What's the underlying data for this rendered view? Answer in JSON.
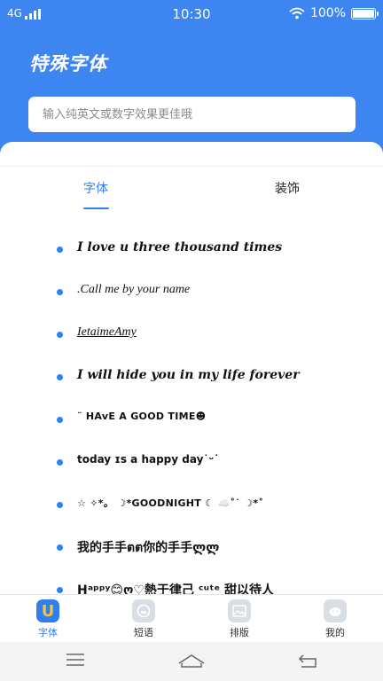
{
  "status_bar": {
    "network": "4G",
    "time": "10:30",
    "battery": "100%"
  },
  "app_title": "特殊字体",
  "search": {
    "placeholder": "输入纯英文或数字效果更佳哦",
    "value": ""
  },
  "tabs": [
    {
      "label": "字体",
      "active": true
    },
    {
      "label": "装饰",
      "active": false
    }
  ],
  "font_samples": [
    {
      "text": "I love u three thousand times"
    },
    {
      "text": ".Call me by your name"
    },
    {
      "text": "IetaimeAmy"
    },
    {
      "text": "I will hide you in my life forever"
    },
    {
      "text": "¨ HAvE A GOOD TIME☻"
    },
    {
      "text": "today ɪs a happy day˙ᵕ˙"
    },
    {
      "text": "☆ ✧*。 ☽*GOODNIGHT ☾ ☁️˚˙ ☽*˚"
    },
    {
      "text": "我的手手ตต你的手手ლლ"
    },
    {
      "text": "Hᵃᵖᵖʸ😊ღ♡熱于律己     ᶜᵘᵗᵉ 甜以待人"
    }
  ],
  "bottom_nav": [
    {
      "label": "字体",
      "icon": "font-u-icon",
      "active": true
    },
    {
      "label": "短语",
      "icon": "phrase-icon",
      "active": false
    },
    {
      "label": "排版",
      "icon": "image-icon",
      "active": false
    },
    {
      "label": "我的",
      "icon": "profile-face-icon",
      "active": false
    }
  ],
  "colors": {
    "primary": "#3d86f2",
    "accent": "#2f7ff0",
    "text": "#111111"
  }
}
